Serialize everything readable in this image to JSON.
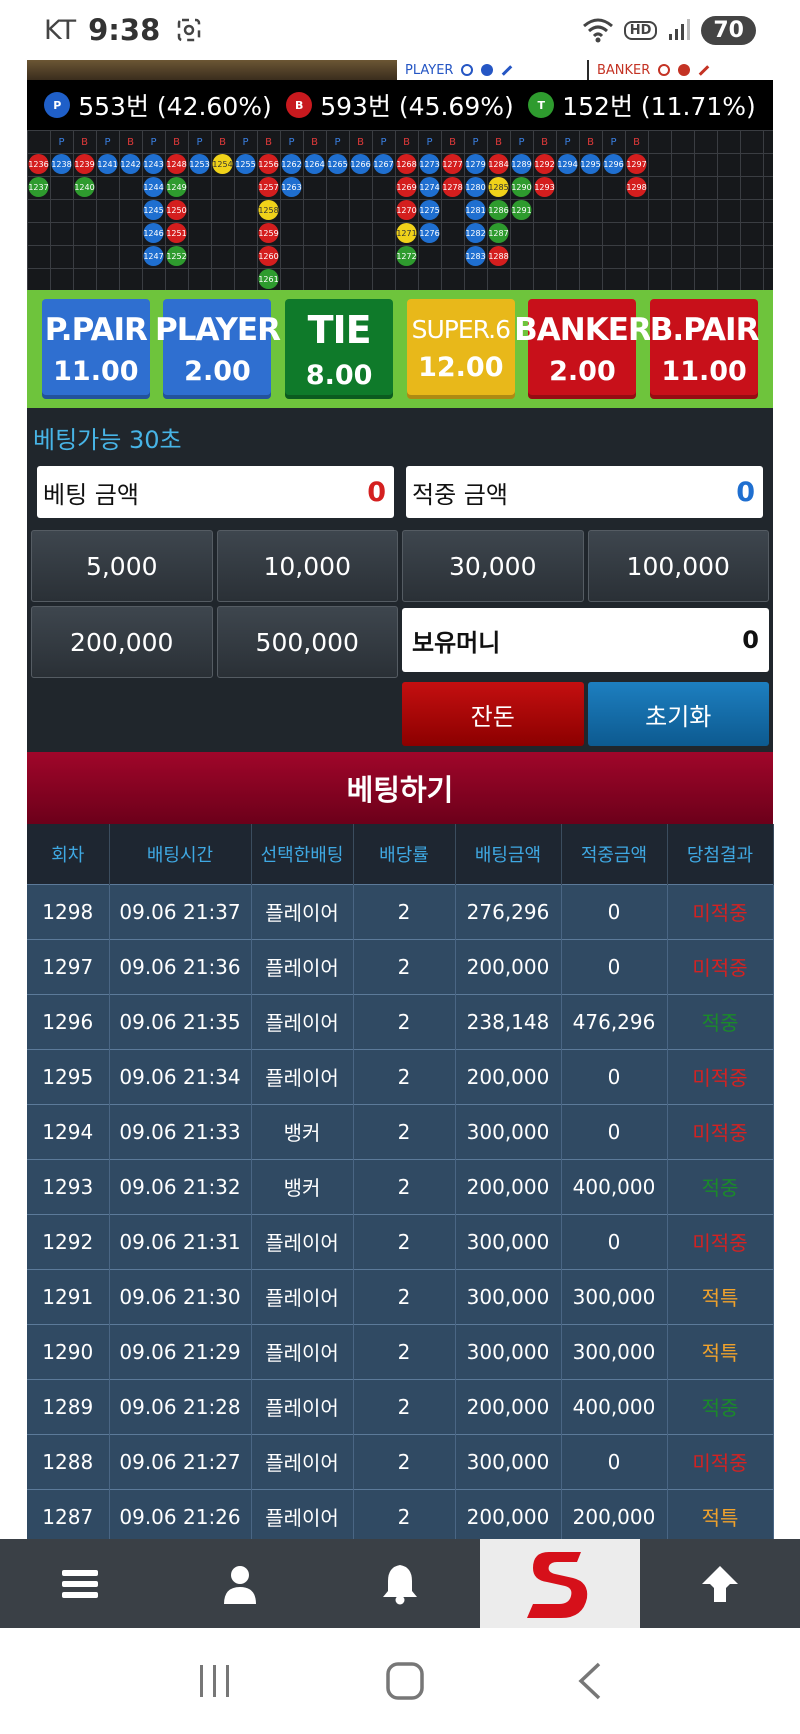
{
  "status_bar": {
    "carrier": "KT",
    "time": "9:38",
    "battery": "70",
    "hd": "HD"
  },
  "legend": {
    "player": "PLAYER",
    "banker": "BANKER"
  },
  "stats": [
    {
      "badge": "P",
      "text": "553번 (42.60%)",
      "color": "#1f5fc8"
    },
    {
      "badge": "B",
      "text": "593번 (45.69%)",
      "color": "#c8191e"
    },
    {
      "badge": "T",
      "text": "152번 (11.71%)",
      "color": "#2e9b2e"
    }
  ],
  "road": {
    "header_labels": [
      "P",
      "B",
      "P",
      "B",
      "P",
      "B",
      "P",
      "B",
      "P",
      "B",
      "P",
      "B",
      "P",
      "B",
      "P",
      "B",
      "P",
      "B",
      "P",
      "B",
      "P",
      "B",
      "P",
      "B",
      "P",
      "B"
    ],
    "columns": [
      [
        {
          "n": "1236",
          "c": "r"
        },
        {
          "n": "1237",
          "c": "g"
        }
      ],
      [
        {
          "n": "1238",
          "c": "b"
        }
      ],
      [
        {
          "n": "1239",
          "c": "r"
        },
        {
          "n": "1240",
          "c": "g"
        }
      ],
      [
        {
          "n": "1241",
          "c": "b"
        }
      ],
      [
        {
          "n": "1242",
          "c": "b"
        }
      ],
      [
        {
          "n": "1243",
          "c": "b"
        },
        {
          "n": "1244",
          "c": "b"
        },
        {
          "n": "1245",
          "c": "b"
        },
        {
          "n": "1246",
          "c": "b"
        },
        {
          "n": "1247",
          "c": "b"
        }
      ],
      [
        {
          "n": "1248",
          "c": "r"
        },
        {
          "n": "1249",
          "c": "g"
        },
        {
          "n": "1250",
          "c": "r"
        },
        {
          "n": "1251",
          "c": "r"
        },
        {
          "n": "1252",
          "c": "g"
        }
      ],
      [
        {
          "n": "1253",
          "c": "b"
        }
      ],
      [
        {
          "n": "1254",
          "c": "y"
        }
      ],
      [
        {
          "n": "1255",
          "c": "b"
        }
      ],
      [
        {
          "n": "1256",
          "c": "r"
        },
        {
          "n": "1257",
          "c": "r"
        },
        {
          "n": "1258",
          "c": "y"
        },
        {
          "n": "1259",
          "c": "r"
        },
        {
          "n": "1260",
          "c": "r"
        },
        {
          "n": "1261",
          "c": "g"
        }
      ],
      [
        {
          "n": "1262",
          "c": "b"
        },
        {
          "n": "1263",
          "c": "b"
        }
      ],
      [
        {
          "n": "1264",
          "c": "b"
        }
      ],
      [
        {
          "n": "1265",
          "c": "b"
        }
      ],
      [
        {
          "n": "1266",
          "c": "b"
        }
      ],
      [
        {
          "n": "1267",
          "c": "b"
        }
      ],
      [
        {
          "n": "1268",
          "c": "r"
        },
        {
          "n": "1269",
          "c": "r"
        },
        {
          "n": "1270",
          "c": "r"
        },
        {
          "n": "1271",
          "c": "y"
        },
        {
          "n": "1272",
          "c": "g"
        }
      ],
      [
        {
          "n": "1273",
          "c": "b"
        },
        {
          "n": "1274",
          "c": "b"
        },
        {
          "n": "1275",
          "c": "b"
        },
        {
          "n": "1276",
          "c": "b"
        }
      ],
      [
        {
          "n": "1277",
          "c": "r"
        },
        {
          "n": "1278",
          "c": "r"
        }
      ],
      [
        {
          "n": "1279",
          "c": "b"
        },
        {
          "n": "1280",
          "c": "b"
        },
        {
          "n": "1281",
          "c": "b"
        },
        {
          "n": "1282",
          "c": "b"
        },
        {
          "n": "1283",
          "c": "b"
        }
      ],
      [
        {
          "n": "1284",
          "c": "r"
        },
        {
          "n": "1285",
          "c": "y"
        },
        {
          "n": "1286",
          "c": "g"
        },
        {
          "n": "1287",
          "c": "g"
        },
        {
          "n": "1288",
          "c": "r"
        }
      ],
      [
        {
          "n": "1289",
          "c": "b"
        },
        {
          "n": "1290",
          "c": "g"
        },
        {
          "n": "1291",
          "c": "g"
        }
      ],
      [
        {
          "n": "1292",
          "c": "r"
        },
        {
          "n": "1293",
          "c": "r"
        }
      ],
      [
        {
          "n": "1294",
          "c": "b"
        }
      ],
      [
        {
          "n": "1295",
          "c": "b"
        }
      ],
      [
        {
          "n": "1296",
          "c": "b"
        }
      ],
      [
        {
          "n": "1297",
          "c": "r"
        },
        {
          "n": "1298",
          "c": "r"
        }
      ]
    ]
  },
  "bets": [
    {
      "name": "P.PAIR",
      "odds": "11.00",
      "color": "#2f6fd0"
    },
    {
      "name": "PLAYER",
      "odds": "2.00",
      "color": "#2f6fd0"
    },
    {
      "name": "TIE",
      "odds": "8.00",
      "color": "#0f7a2a"
    },
    {
      "name": "SUPER.6",
      "odds": "12.00",
      "color": "#e8b81a"
    },
    {
      "name": "BANKER",
      "odds": "2.00",
      "color": "#c8101a"
    },
    {
      "name": "B.PAIR",
      "odds": "11.00",
      "color": "#c8101a"
    }
  ],
  "betting": {
    "countdown": "베팅가능 30초",
    "bet_amount_label": "베팅 금액",
    "bet_amount_value": "0",
    "win_amount_label": "적중 금액",
    "win_amount_value": "0",
    "chips": [
      "5,000",
      "10,000",
      "30,000",
      "100,000",
      "200,000",
      "500,000"
    ],
    "money_label": "보유머니",
    "money_value": "0",
    "change_label": "잔돈",
    "reset_label": "초기화",
    "submit_label": "베팅하기"
  },
  "history": {
    "headers": [
      "회차",
      "배팅시간",
      "선택한배팅",
      "배당률",
      "배팅금액",
      "적중금액",
      "당첨결과"
    ],
    "rows": [
      [
        "1298",
        "09.06 21:37",
        "플레이어",
        "2",
        "276,296",
        "0",
        "미적중",
        "miss"
      ],
      [
        "1297",
        "09.06 21:36",
        "플레이어",
        "2",
        "200,000",
        "0",
        "미적중",
        "miss"
      ],
      [
        "1296",
        "09.06 21:35",
        "플레이어",
        "2",
        "238,148",
        "476,296",
        "적중",
        "hit"
      ],
      [
        "1295",
        "09.06 21:34",
        "플레이어",
        "2",
        "200,000",
        "0",
        "미적중",
        "miss"
      ],
      [
        "1294",
        "09.06 21:33",
        "뱅커",
        "2",
        "300,000",
        "0",
        "미적중",
        "miss"
      ],
      [
        "1293",
        "09.06 21:32",
        "뱅커",
        "2",
        "200,000",
        "400,000",
        "적중",
        "hit"
      ],
      [
        "1292",
        "09.06 21:31",
        "플레이어",
        "2",
        "300,000",
        "0",
        "미적중",
        "miss"
      ],
      [
        "1291",
        "09.06 21:30",
        "플레이어",
        "2",
        "300,000",
        "300,000",
        "적특",
        "special"
      ],
      [
        "1290",
        "09.06 21:29",
        "플레이어",
        "2",
        "300,000",
        "300,000",
        "적특",
        "special"
      ],
      [
        "1289",
        "09.06 21:28",
        "플레이어",
        "2",
        "200,000",
        "400,000",
        "적중",
        "hit"
      ],
      [
        "1288",
        "09.06 21:27",
        "플레이어",
        "2",
        "300,000",
        "0",
        "미적중",
        "miss"
      ],
      [
        "1287",
        "09.06 21:26",
        "플레이어",
        "2",
        "200,000",
        "200,000",
        "적특",
        "special"
      ]
    ]
  },
  "bottom_nav": [
    "menu-icon",
    "user-icon",
    "bell-icon",
    "logo",
    "arrow-up-icon"
  ],
  "colors": {
    "player": "#1f5fc8",
    "banker": "#c8191e",
    "tie": "#2e9b2e",
    "super6": "#f0d21a"
  }
}
